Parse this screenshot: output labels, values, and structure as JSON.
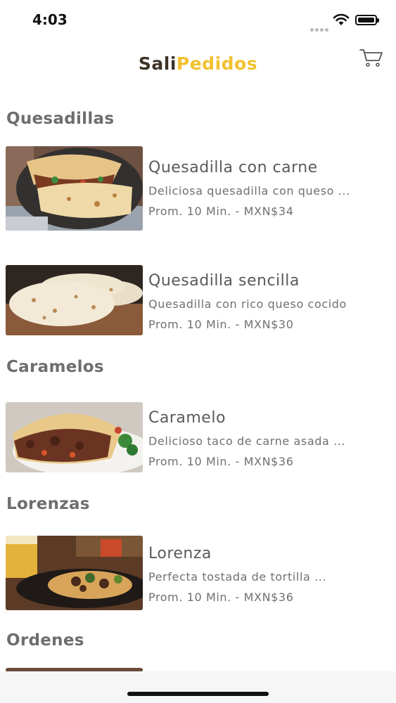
{
  "status_bar": {
    "time": "4:03"
  },
  "header": {
    "brand_part1": "Sali",
    "brand_part2": "Pedidos",
    "brand_colors": {
      "primary": "#3c3326",
      "accent": "#f2c12e"
    },
    "cart_icon": "cart-icon"
  },
  "sections": [
    {
      "title": "Quesadillas"
    },
    {
      "title": "Caramelos"
    },
    {
      "title": "Lorenzas"
    },
    {
      "title": "Ordenes"
    }
  ],
  "items": [
    {
      "name": "Quesadilla con carne",
      "description": "Deliciosa quesadilla con queso ...",
      "meta": "Prom. 10 Min. - MXN$34"
    },
    {
      "name": "Quesadilla sencilla",
      "description": "Quesadilla con rico queso cocido",
      "meta": "Prom. 10 Min. - MXN$30"
    },
    {
      "name": "Caramelo",
      "description": "Delicioso taco de carne asada ...",
      "meta": "Prom. 10 Min. - MXN$36"
    },
    {
      "name": "Lorenza",
      "description": "Perfecta tostada de tortilla ...",
      "meta": "Prom. 10 Min. - MXN$36"
    }
  ]
}
